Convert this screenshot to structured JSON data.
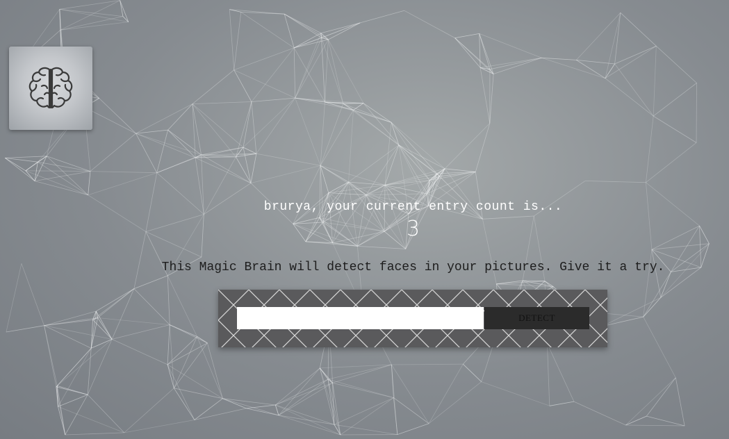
{
  "logo": {
    "icon": "brain-icon"
  },
  "rank": {
    "message": "brurya, your current entry count is...",
    "count": "3"
  },
  "intro": {
    "text": "This Magic Brain will detect faces in your pictures. Give it a try."
  },
  "form": {
    "input_value": "",
    "input_placeholder": "",
    "button_label": "DETECT"
  },
  "colors": {
    "background": "#969b9e",
    "panel": "#5c5c5e",
    "button": "#2b2b2b",
    "network_lines": "#e8eaeb"
  }
}
